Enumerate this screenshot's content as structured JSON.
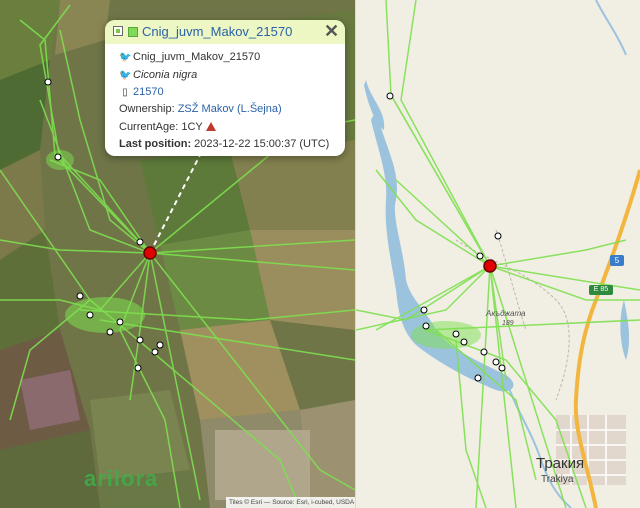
{
  "popup": {
    "title": "Cnig_juvm_Makov_21570",
    "name": "Cnig_juvm_Makov_21570",
    "species": "Ciconia nigra",
    "tag_id": "21570",
    "ownership_label": "Ownership:",
    "ownership_value": "ZSŽ Makov (L.Šejna)",
    "age_label": "CurrentAge:",
    "age_value": "1CY",
    "last_position_label": "Last position:",
    "last_position_value": "2023-12-22 15:00:37 (UTC)",
    "close_symbol": "✕"
  },
  "map_left": {
    "logo": "arilora",
    "attribution": "Tiles © Esri — Source: Esri, i-cubed, USDA"
  },
  "map_right": {
    "road_shield": "5",
    "road_code": "E 85",
    "village_name": "Акъджата",
    "village_sub": "189",
    "town_name": "Тракия",
    "town_latin": "Trakiya"
  },
  "colors": {
    "track": "#7ee04f",
    "last_marker": "#e00000",
    "water": "#9cc3de",
    "highway": "#f2b640"
  }
}
